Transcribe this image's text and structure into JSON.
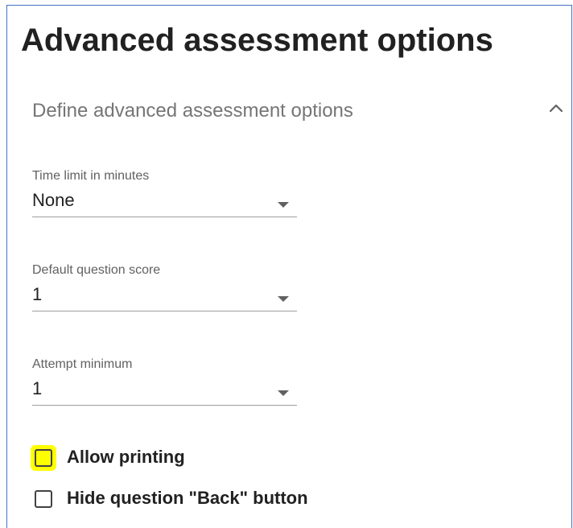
{
  "page": {
    "title": "Advanced assessment options"
  },
  "section": {
    "title": "Define advanced assessment options",
    "collapse_icon": "chevron-up-icon"
  },
  "fields": [
    {
      "label": "Time limit in minutes",
      "value": "None"
    },
    {
      "label": "Default question score",
      "value": "1"
    },
    {
      "label": "Attempt minimum",
      "value": "1"
    }
  ],
  "checkboxes": [
    {
      "label": "Allow printing",
      "checked": false,
      "highlighted": true
    },
    {
      "label": "Hide question \"Back\" button",
      "checked": false,
      "highlighted": false
    }
  ],
  "colors": {
    "highlight": "#ffff00",
    "frame_border": "#4472c4",
    "section_title": "#757575"
  }
}
